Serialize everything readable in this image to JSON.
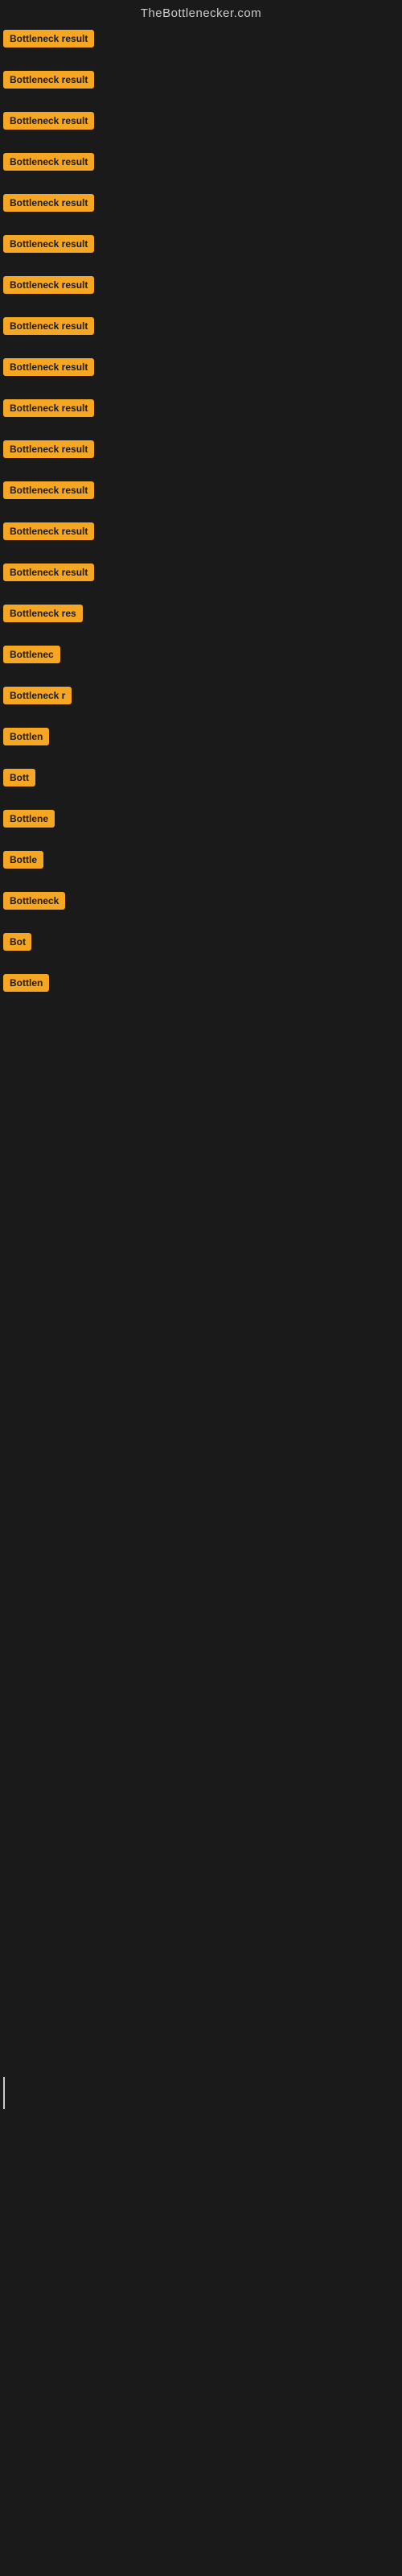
{
  "header": {
    "title": "TheBottlenecker.com"
  },
  "items": [
    {
      "id": 1,
      "label": "Bottleneck result",
      "width": 120
    },
    {
      "id": 2,
      "label": "Bottleneck result",
      "width": 120
    },
    {
      "id": 3,
      "label": "Bottleneck result",
      "width": 120
    },
    {
      "id": 4,
      "label": "Bottleneck result",
      "width": 120
    },
    {
      "id": 5,
      "label": "Bottleneck result",
      "width": 120
    },
    {
      "id": 6,
      "label": "Bottleneck result",
      "width": 120
    },
    {
      "id": 7,
      "label": "Bottleneck result",
      "width": 120
    },
    {
      "id": 8,
      "label": "Bottleneck result",
      "width": 120
    },
    {
      "id": 9,
      "label": "Bottleneck result",
      "width": 120
    },
    {
      "id": 10,
      "label": "Bottleneck result",
      "width": 120
    },
    {
      "id": 11,
      "label": "Bottleneck result",
      "width": 120
    },
    {
      "id": 12,
      "label": "Bottleneck result",
      "width": 120
    },
    {
      "id": 13,
      "label": "Bottleneck result",
      "width": 120
    },
    {
      "id": 14,
      "label": "Bottleneck result",
      "width": 120
    },
    {
      "id": 15,
      "label": "Bottleneck res",
      "width": 100
    },
    {
      "id": 16,
      "label": "Bottlenec",
      "width": 75
    },
    {
      "id": 17,
      "label": "Bottleneck r",
      "width": 85
    },
    {
      "id": 18,
      "label": "Bottlen",
      "width": 65
    },
    {
      "id": 19,
      "label": "Bott",
      "width": 42
    },
    {
      "id": 20,
      "label": "Bottlene",
      "width": 68
    },
    {
      "id": 21,
      "label": "Bottle",
      "width": 55
    },
    {
      "id": 22,
      "label": "Bottleneck",
      "width": 78
    },
    {
      "id": 23,
      "label": "Bot",
      "width": 35
    },
    {
      "id": 24,
      "label": "Bottlen",
      "width": 62
    }
  ]
}
